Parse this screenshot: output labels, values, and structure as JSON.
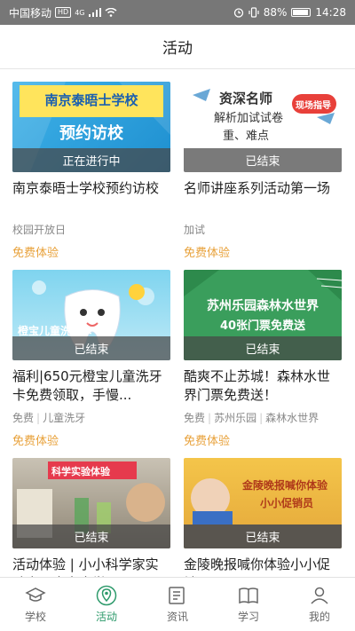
{
  "status_bar": {
    "carrier": "中国移动",
    "hd": "HD",
    "signal": "4G",
    "battery": "88%",
    "time": "14:28"
  },
  "header": {
    "title": "活动"
  },
  "cards": [
    {
      "thumb_title_line1": "南京泰晤士学校",
      "thumb_title_line2": "预约访校",
      "status": "正在进行中",
      "title": "南京泰晤士学校预约访校",
      "tags": [
        "校园开放日"
      ],
      "price": "免费体验"
    },
    {
      "thumb_title_line1": "资深名师",
      "thumb_title_line2": "解析加试试卷",
      "thumb_title_line3": "重、难点",
      "thumb_badge": "现场指导",
      "status": "已结束",
      "title": "名师讲座系列活动第一场",
      "tags": [
        "加试"
      ],
      "price": "免费体验"
    },
    {
      "thumb_title_line1": "橙宝儿童洗牙卡",
      "status": "已结束",
      "title": "福利|650元橙宝儿童洗牙卡免费领取，手慢...",
      "tags": [
        "免费",
        "儿童洗牙"
      ],
      "price": "免费体验"
    },
    {
      "thumb_title_line1": "苏州乐园森林水世界",
      "thumb_title_line2": "40张门票免费送",
      "status": "已结束",
      "title": "酷爽不止苏城！森林水世界门票免费送！",
      "tags": [
        "免费",
        "苏州乐园",
        "森林水世界"
      ],
      "price": "免费体验"
    },
    {
      "thumb_title_line1": "科学实验体验",
      "status": "已结束",
      "title": "活动体验 | 小小科学家实验室，南京大学团...",
      "tags": [],
      "price": ""
    },
    {
      "thumb_title_line1": "金陵晚报喊你体验",
      "thumb_title_line2": "小小促销员",
      "status": "已结束",
      "title": "金陵晚报喊你体验小小促销员",
      "tags": [],
      "price": ""
    }
  ],
  "bottom_nav": [
    {
      "label": "学校",
      "icon": "school-icon"
    },
    {
      "label": "活动",
      "icon": "location-icon",
      "active": true
    },
    {
      "label": "资讯",
      "icon": "news-icon"
    },
    {
      "label": "学习",
      "icon": "book-icon"
    },
    {
      "label": "我的",
      "icon": "person-icon"
    }
  ],
  "colors": {
    "accent": "#2d9a6b",
    "price": "#e8a13a"
  }
}
